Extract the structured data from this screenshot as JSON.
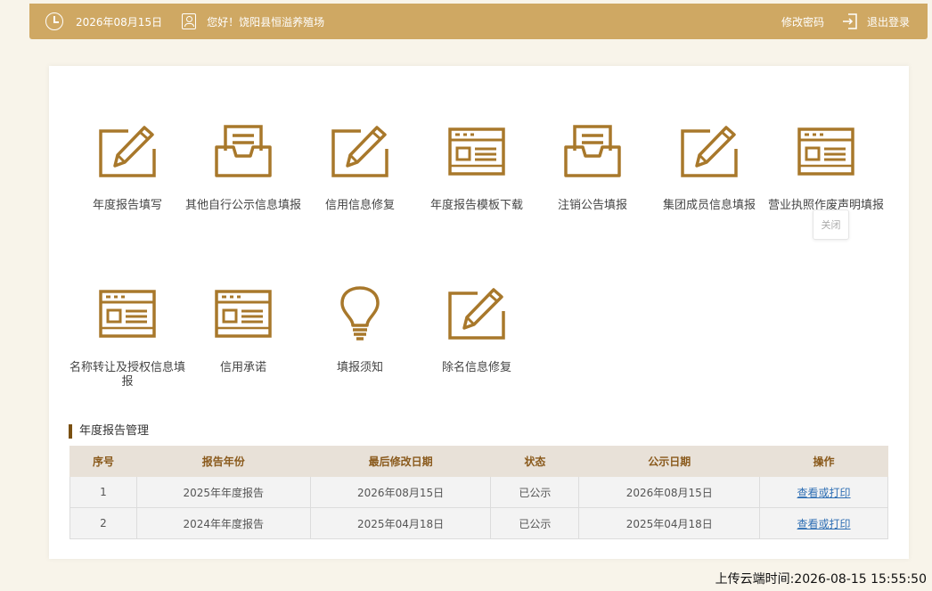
{
  "header": {
    "date": "2026年08月15日",
    "greeting": "您好！饶阳县恒溢养殖场",
    "change_password": "修改密码",
    "logout": "退出登录"
  },
  "tiles": [
    {
      "label": "年度报告填写",
      "icon": "pencil-edit-icon"
    },
    {
      "label": "其他自行公示信息填报",
      "icon": "inbox-tray-icon"
    },
    {
      "label": "信用信息修复",
      "icon": "pencil-edit-icon"
    },
    {
      "label": "年度报告模板下载",
      "icon": "browser-window-icon"
    },
    {
      "label": "注销公告填报",
      "icon": "inbox-tray-icon"
    },
    {
      "label": "集团成员信息填报",
      "icon": "pencil-edit-icon"
    },
    {
      "label": "营业执照作废声明填报",
      "icon": "browser-window-icon"
    },
    {
      "label": "名称转让及授权信息填报",
      "icon": "browser-window-icon"
    },
    {
      "label": "信用承诺",
      "icon": "browser-window-icon"
    },
    {
      "label": "填报须知",
      "icon": "lightbulb-icon"
    },
    {
      "label": "除名信息修复",
      "icon": "pencil-edit-icon"
    }
  ],
  "tooltip": "关闭",
  "section": {
    "title": "年度报告管理",
    "columns": [
      "序号",
      "报告年份",
      "最后修改日期",
      "状态",
      "公示日期",
      "操作"
    ],
    "rows": [
      {
        "no": "1",
        "year": "2025年年度报告",
        "modified": "2026年08月15日",
        "status": "已公示",
        "published": "2026年08月15日",
        "action": "查看或打印"
      },
      {
        "no": "2",
        "year": "2024年年度报告",
        "modified": "2025年04月18日",
        "status": "已公示",
        "published": "2025年04月18日",
        "action": "查看或打印"
      }
    ]
  },
  "footer": {
    "upload_time": "上传云端时间:2026-08-15 15:55:50"
  },
  "colors": {
    "accent": "#cfa863",
    "icon": "#a8782b",
    "table_header_bg": "#e8e1d8",
    "link": "#2f6fb4"
  }
}
